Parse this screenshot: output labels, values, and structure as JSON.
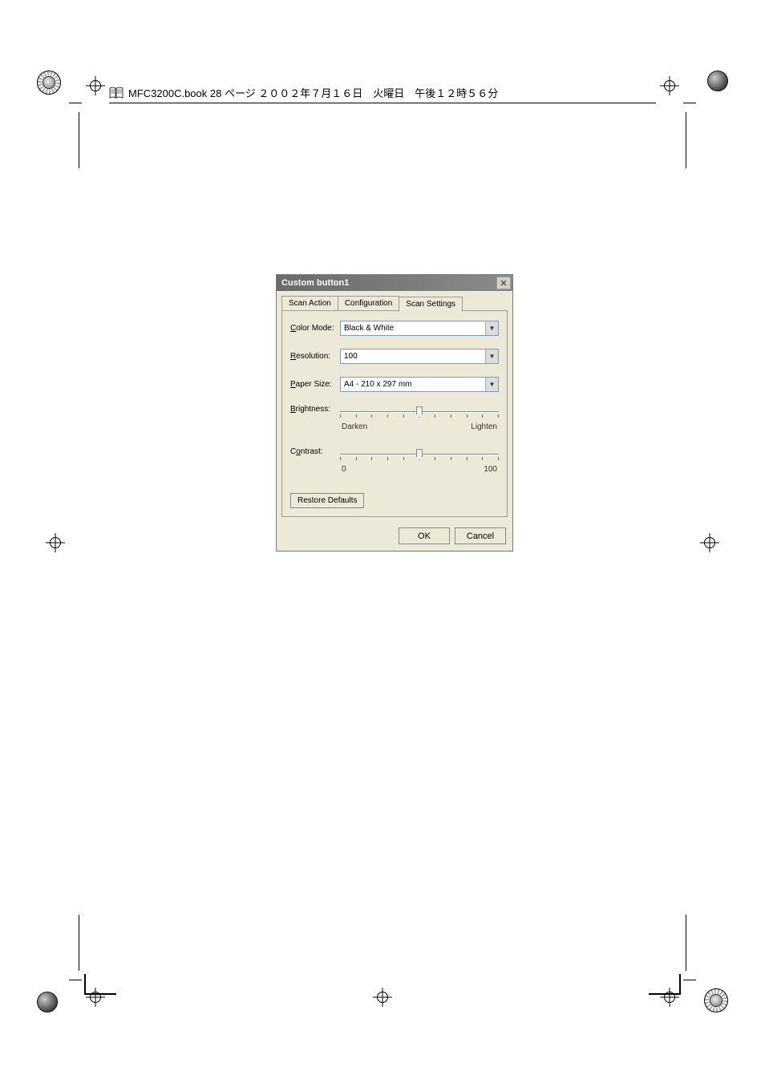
{
  "header": {
    "text": "MFC3200C.book 28 ページ ２００２年７月１６日　火曜日　午後１２時５６分"
  },
  "dialog": {
    "title": "Custom button1",
    "tabs": {
      "scan_action": "Scan Action",
      "configuration": "Configuration",
      "scan_settings": "Scan Settings"
    },
    "labels": {
      "color_mode": "Color Mode:",
      "resolution": "Resolution:",
      "paper_size": "Paper Size:",
      "brightness": "Brightness:",
      "contrast": "Contrast:"
    },
    "values": {
      "color_mode": "Black & White",
      "resolution": "100",
      "paper_size": "A4 - 210 x 297 mm"
    },
    "slider_labels": {
      "brightness_min": "Darken",
      "brightness_max": "Lighten",
      "contrast_min": "0",
      "contrast_max": "100"
    },
    "buttons": {
      "restore": "Restore Defaults",
      "ok": "OK",
      "cancel": "Cancel"
    }
  }
}
